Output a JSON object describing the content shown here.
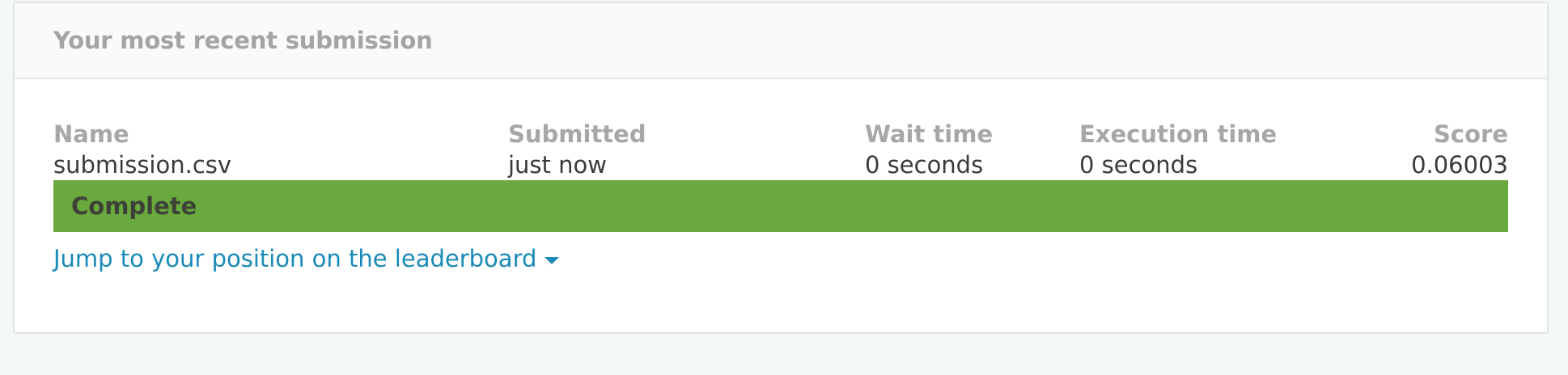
{
  "header": {
    "title": "Your most recent submission"
  },
  "submission": {
    "name_label": "Name",
    "name_value": "submission.csv",
    "submitted_label": "Submitted",
    "submitted_value": "just now",
    "wait_label": "Wait time",
    "wait_value": "0 seconds",
    "exec_label": "Execution time",
    "exec_value": "0 seconds",
    "score_label": "Score",
    "score_value": "0.06003"
  },
  "status": {
    "text": "Complete",
    "color": "#6aa93d"
  },
  "leaderboard_link": {
    "text": "Jump to your position on the leaderboard",
    "icon": "caret-down-icon"
  }
}
